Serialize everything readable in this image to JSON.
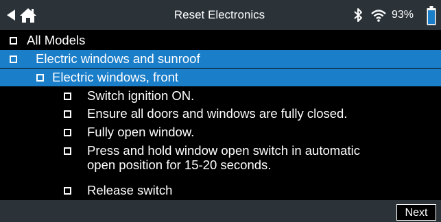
{
  "header": {
    "title": "Reset Electronics",
    "battery_percent": "93%",
    "battery_level": 0.93,
    "icons": [
      "back-arrow-icon",
      "home-icon",
      "bluetooth-icon",
      "wifi-icon",
      "battery-icon"
    ]
  },
  "tree": {
    "all_models": "All Models",
    "category": "Electric windows and sunroof",
    "subcategory": "Electric windows, front",
    "steps": [
      "Switch ignition ON.",
      "Ensure all doors and windows are fully closed.",
      "Fully open window.",
      "Press and hold window open switch in automatic",
      "open position for 15-20 seconds.",
      "Release switch"
    ]
  },
  "footer": {
    "next_label": "Next"
  },
  "colors": {
    "header_bg": "#2b3339",
    "highlight": "#1b7ec9",
    "background": "#000000",
    "battery": "#1b7ec9"
  }
}
